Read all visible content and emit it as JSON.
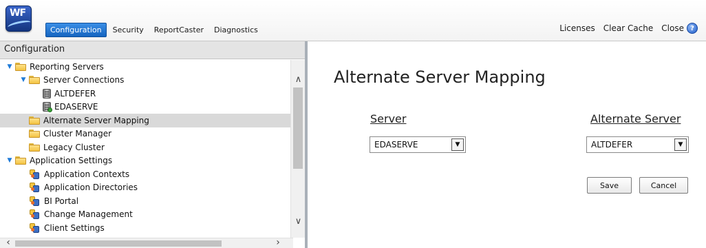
{
  "header": {
    "logo_text": "WF",
    "nav_tabs": [
      {
        "label": "Configuration",
        "active": true
      },
      {
        "label": "Security",
        "active": false
      },
      {
        "label": "ReportCaster",
        "active": false
      },
      {
        "label": "Diagnostics",
        "active": false
      }
    ],
    "actions": {
      "licenses": "Licenses",
      "clear_cache": "Clear Cache",
      "close": "Close"
    },
    "help_icon": "?",
    "accent_color": "#1565c0"
  },
  "sidebar": {
    "title": "Configuration",
    "tree": [
      {
        "label": "Reporting Servers",
        "icon": "folder-open-icon",
        "expanded": true
      },
      {
        "label": "Server Connections",
        "icon": "folder-open-icon",
        "expanded": true
      },
      {
        "label": "ALTDEFER",
        "icon": "server-icon"
      },
      {
        "label": "EDASERVE",
        "icon": "server-check-icon"
      },
      {
        "label": "Alternate Server Mapping",
        "icon": "folder-icon",
        "selected": true
      },
      {
        "label": "Cluster Manager",
        "icon": "folder-icon"
      },
      {
        "label": "Legacy Cluster",
        "icon": "folder-icon"
      },
      {
        "label": "Application Settings",
        "icon": "folder-open-icon",
        "expanded": true
      },
      {
        "label": "Application Contexts",
        "icon": "app-settings-icon"
      },
      {
        "label": "Application Directories",
        "icon": "app-settings-icon"
      },
      {
        "label": "BI Portal",
        "icon": "app-settings-icon"
      },
      {
        "label": "Change Management",
        "icon": "app-settings-icon"
      },
      {
        "label": "Client Settings",
        "icon": "app-settings-icon"
      }
    ]
  },
  "main": {
    "title": "Alternate Server Mapping",
    "server_label": "Server",
    "alternate_label": "Alternate Server",
    "server_value": "EDASERVE",
    "alternate_value": "ALTDEFER",
    "save_label": "Save",
    "cancel_label": "Cancel"
  }
}
